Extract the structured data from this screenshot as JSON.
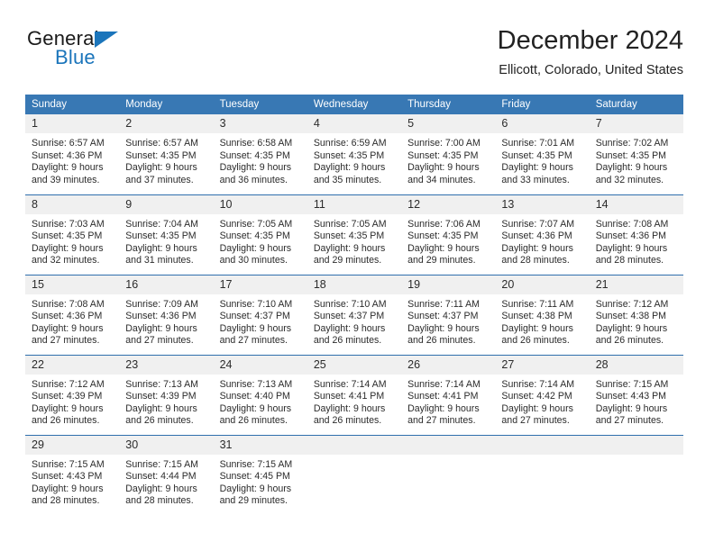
{
  "brand": {
    "name_top": "General",
    "name_bottom": "Blue",
    "accent_color": "#1b75bb",
    "logo_icon": "triangle-flag-icon"
  },
  "header": {
    "month_title": "December 2024",
    "location": "Ellicott, Colorado, United States"
  },
  "colors": {
    "header_row": "#3878b4",
    "row_divider": "#2f6fad",
    "daynum_band": "#f0f0f0",
    "text": "#2b2b2b"
  },
  "calendar": {
    "weekday_headers": [
      "Sunday",
      "Monday",
      "Tuesday",
      "Wednesday",
      "Thursday",
      "Friday",
      "Saturday"
    ],
    "weeks": [
      [
        {
          "day": "1",
          "sunrise": "Sunrise: 6:57 AM",
          "sunset": "Sunset: 4:36 PM",
          "daylight_line1": "Daylight: 9 hours",
          "daylight_line2": "and 39 minutes."
        },
        {
          "day": "2",
          "sunrise": "Sunrise: 6:57 AM",
          "sunset": "Sunset: 4:35 PM",
          "daylight_line1": "Daylight: 9 hours",
          "daylight_line2": "and 37 minutes."
        },
        {
          "day": "3",
          "sunrise": "Sunrise: 6:58 AM",
          "sunset": "Sunset: 4:35 PM",
          "daylight_line1": "Daylight: 9 hours",
          "daylight_line2": "and 36 minutes."
        },
        {
          "day": "4",
          "sunrise": "Sunrise: 6:59 AM",
          "sunset": "Sunset: 4:35 PM",
          "daylight_line1": "Daylight: 9 hours",
          "daylight_line2": "and 35 minutes."
        },
        {
          "day": "5",
          "sunrise": "Sunrise: 7:00 AM",
          "sunset": "Sunset: 4:35 PM",
          "daylight_line1": "Daylight: 9 hours",
          "daylight_line2": "and 34 minutes."
        },
        {
          "day": "6",
          "sunrise": "Sunrise: 7:01 AM",
          "sunset": "Sunset: 4:35 PM",
          "daylight_line1": "Daylight: 9 hours",
          "daylight_line2": "and 33 minutes."
        },
        {
          "day": "7",
          "sunrise": "Sunrise: 7:02 AM",
          "sunset": "Sunset: 4:35 PM",
          "daylight_line1": "Daylight: 9 hours",
          "daylight_line2": "and 32 minutes."
        }
      ],
      [
        {
          "day": "8",
          "sunrise": "Sunrise: 7:03 AM",
          "sunset": "Sunset: 4:35 PM",
          "daylight_line1": "Daylight: 9 hours",
          "daylight_line2": "and 32 minutes."
        },
        {
          "day": "9",
          "sunrise": "Sunrise: 7:04 AM",
          "sunset": "Sunset: 4:35 PM",
          "daylight_line1": "Daylight: 9 hours",
          "daylight_line2": "and 31 minutes."
        },
        {
          "day": "10",
          "sunrise": "Sunrise: 7:05 AM",
          "sunset": "Sunset: 4:35 PM",
          "daylight_line1": "Daylight: 9 hours",
          "daylight_line2": "and 30 minutes."
        },
        {
          "day": "11",
          "sunrise": "Sunrise: 7:05 AM",
          "sunset": "Sunset: 4:35 PM",
          "daylight_line1": "Daylight: 9 hours",
          "daylight_line2": "and 29 minutes."
        },
        {
          "day": "12",
          "sunrise": "Sunrise: 7:06 AM",
          "sunset": "Sunset: 4:35 PM",
          "daylight_line1": "Daylight: 9 hours",
          "daylight_line2": "and 29 minutes."
        },
        {
          "day": "13",
          "sunrise": "Sunrise: 7:07 AM",
          "sunset": "Sunset: 4:36 PM",
          "daylight_line1": "Daylight: 9 hours",
          "daylight_line2": "and 28 minutes."
        },
        {
          "day": "14",
          "sunrise": "Sunrise: 7:08 AM",
          "sunset": "Sunset: 4:36 PM",
          "daylight_line1": "Daylight: 9 hours",
          "daylight_line2": "and 28 minutes."
        }
      ],
      [
        {
          "day": "15",
          "sunrise": "Sunrise: 7:08 AM",
          "sunset": "Sunset: 4:36 PM",
          "daylight_line1": "Daylight: 9 hours",
          "daylight_line2": "and 27 minutes."
        },
        {
          "day": "16",
          "sunrise": "Sunrise: 7:09 AM",
          "sunset": "Sunset: 4:36 PM",
          "daylight_line1": "Daylight: 9 hours",
          "daylight_line2": "and 27 minutes."
        },
        {
          "day": "17",
          "sunrise": "Sunrise: 7:10 AM",
          "sunset": "Sunset: 4:37 PM",
          "daylight_line1": "Daylight: 9 hours",
          "daylight_line2": "and 27 minutes."
        },
        {
          "day": "18",
          "sunrise": "Sunrise: 7:10 AM",
          "sunset": "Sunset: 4:37 PM",
          "daylight_line1": "Daylight: 9 hours",
          "daylight_line2": "and 26 minutes."
        },
        {
          "day": "19",
          "sunrise": "Sunrise: 7:11 AM",
          "sunset": "Sunset: 4:37 PM",
          "daylight_line1": "Daylight: 9 hours",
          "daylight_line2": "and 26 minutes."
        },
        {
          "day": "20",
          "sunrise": "Sunrise: 7:11 AM",
          "sunset": "Sunset: 4:38 PM",
          "daylight_line1": "Daylight: 9 hours",
          "daylight_line2": "and 26 minutes."
        },
        {
          "day": "21",
          "sunrise": "Sunrise: 7:12 AM",
          "sunset": "Sunset: 4:38 PM",
          "daylight_line1": "Daylight: 9 hours",
          "daylight_line2": "and 26 minutes."
        }
      ],
      [
        {
          "day": "22",
          "sunrise": "Sunrise: 7:12 AM",
          "sunset": "Sunset: 4:39 PM",
          "daylight_line1": "Daylight: 9 hours",
          "daylight_line2": "and 26 minutes."
        },
        {
          "day": "23",
          "sunrise": "Sunrise: 7:13 AM",
          "sunset": "Sunset: 4:39 PM",
          "daylight_line1": "Daylight: 9 hours",
          "daylight_line2": "and 26 minutes."
        },
        {
          "day": "24",
          "sunrise": "Sunrise: 7:13 AM",
          "sunset": "Sunset: 4:40 PM",
          "daylight_line1": "Daylight: 9 hours",
          "daylight_line2": "and 26 minutes."
        },
        {
          "day": "25",
          "sunrise": "Sunrise: 7:14 AM",
          "sunset": "Sunset: 4:41 PM",
          "daylight_line1": "Daylight: 9 hours",
          "daylight_line2": "and 26 minutes."
        },
        {
          "day": "26",
          "sunrise": "Sunrise: 7:14 AM",
          "sunset": "Sunset: 4:41 PM",
          "daylight_line1": "Daylight: 9 hours",
          "daylight_line2": "and 27 minutes."
        },
        {
          "day": "27",
          "sunrise": "Sunrise: 7:14 AM",
          "sunset": "Sunset: 4:42 PM",
          "daylight_line1": "Daylight: 9 hours",
          "daylight_line2": "and 27 minutes."
        },
        {
          "day": "28",
          "sunrise": "Sunrise: 7:15 AM",
          "sunset": "Sunset: 4:43 PM",
          "daylight_line1": "Daylight: 9 hours",
          "daylight_line2": "and 27 minutes."
        }
      ],
      [
        {
          "day": "29",
          "sunrise": "Sunrise: 7:15 AM",
          "sunset": "Sunset: 4:43 PM",
          "daylight_line1": "Daylight: 9 hours",
          "daylight_line2": "and 28 minutes."
        },
        {
          "day": "30",
          "sunrise": "Sunrise: 7:15 AM",
          "sunset": "Sunset: 4:44 PM",
          "daylight_line1": "Daylight: 9 hours",
          "daylight_line2": "and 28 minutes."
        },
        {
          "day": "31",
          "sunrise": "Sunrise: 7:15 AM",
          "sunset": "Sunset: 4:45 PM",
          "daylight_line1": "Daylight: 9 hours",
          "daylight_line2": "and 29 minutes."
        },
        {
          "day": "",
          "sunrise": "",
          "sunset": "",
          "daylight_line1": "",
          "daylight_line2": ""
        },
        {
          "day": "",
          "sunrise": "",
          "sunset": "",
          "daylight_line1": "",
          "daylight_line2": ""
        },
        {
          "day": "",
          "sunrise": "",
          "sunset": "",
          "daylight_line1": "",
          "daylight_line2": ""
        },
        {
          "day": "",
          "sunrise": "",
          "sunset": "",
          "daylight_line1": "",
          "daylight_line2": ""
        }
      ]
    ]
  }
}
